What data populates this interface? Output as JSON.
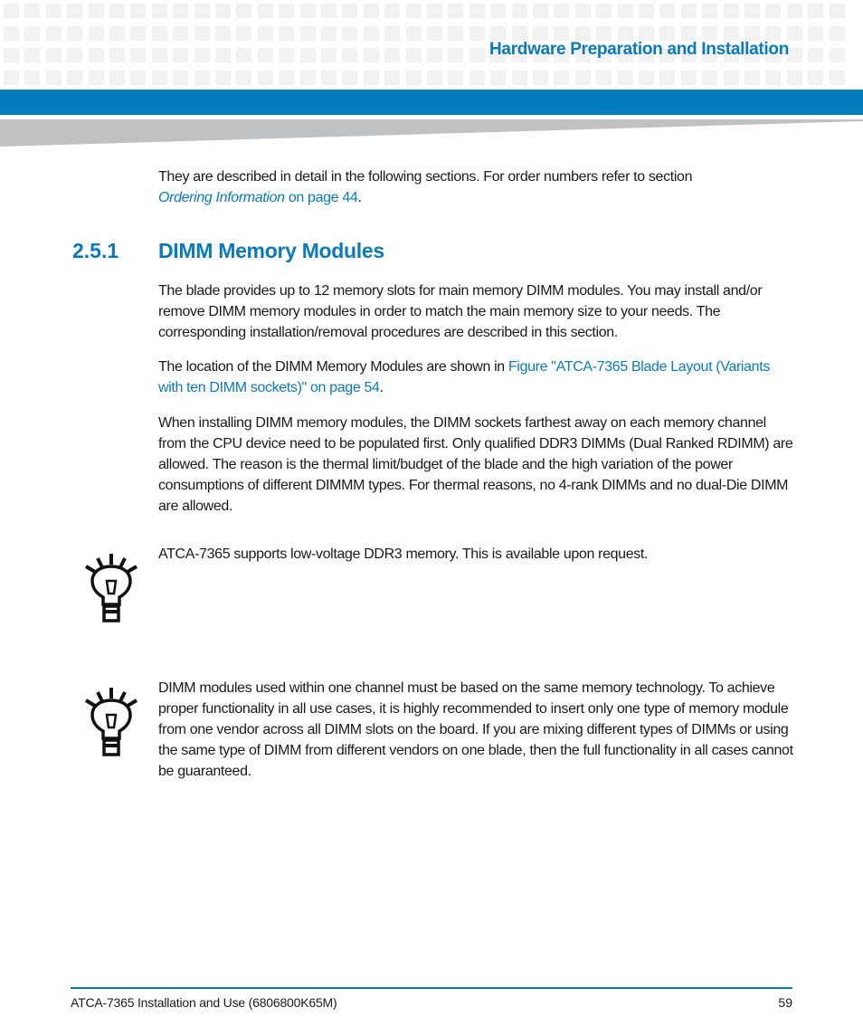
{
  "header": {
    "chapter_title": "Hardware Preparation and Installation"
  },
  "intro": {
    "text": "They are described in detail in the following sections. For order numbers refer to section",
    "link_label": "Ordering Information",
    "link_suffix": " on page 44",
    "end": "."
  },
  "section": {
    "number": "2.5.1",
    "title": "DIMM Memory Modules"
  },
  "paragraphs": {
    "p1": "The blade provides up to 12 memory slots for main memory DIMM modules. You may install and/or remove DIMM memory modules in order to match the main memory size to your needs. The corresponding installation/removal procedures are described in this section.",
    "p2_text": "The location of the DIMM Memory Modules are shown in ",
    "p2_link": "Figure \"ATCA-7365 Blade Layout (Variants with ten DIMM sockets)\" on page 54",
    "p2_end": ".",
    "p3": "When installing DIMM memory modules, the DIMM sockets farthest away on each memory channel from the CPU device need to be populated first. Only qualified DDR3 DIMMs (Dual Ranked RDIMM) are allowed. The reason is the thermal limit/budget of the blade and the high variation of the power consumptions of different DIMMM types. For thermal reasons, no 4-rank DIMMs and no dual-Die DIMM are allowed."
  },
  "notes": [
    {
      "icon": "lightbulb-icon",
      "text": "ATCA-7365 supports low-voltage DDR3 memory. This is available upon request."
    },
    {
      "icon": "lightbulb-icon",
      "text": "DIMM modules used within one channel must be based on the same memory technology. To achieve proper functionality in all use cases, it is highly recommended to insert only one type of memory module from one vendor across all DIMM slots on the board. If you are mixing different types of DIMMs or using the same type of DIMM from different vendors on one blade, then the full functionality in all cases cannot be guaranteed."
    }
  ],
  "footer": {
    "document_title": "ATCA-7365 Installation and Use (6806800K65M)",
    "page_number": "59"
  },
  "colors": {
    "accent_blue": "#037cbd",
    "link_blue": "#0a7abf",
    "wedge_gray": "#c0c1c3"
  }
}
